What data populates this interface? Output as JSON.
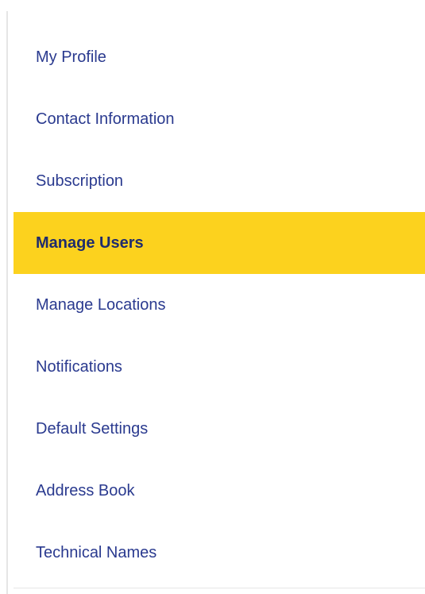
{
  "sidebar": {
    "active_color": "#fcd21e",
    "link_color": "#2a3a8f",
    "items": [
      {
        "label": "My Profile",
        "active": false
      },
      {
        "label": "Contact Information",
        "active": false
      },
      {
        "label": "Subscription",
        "active": false
      },
      {
        "label": "Manage Users",
        "active": true
      },
      {
        "label": "Manage Locations",
        "active": false
      },
      {
        "label": "Notifications",
        "active": false
      },
      {
        "label": "Default Settings",
        "active": false
      },
      {
        "label": "Address Book",
        "active": false
      },
      {
        "label": "Technical Names",
        "active": false
      }
    ]
  }
}
